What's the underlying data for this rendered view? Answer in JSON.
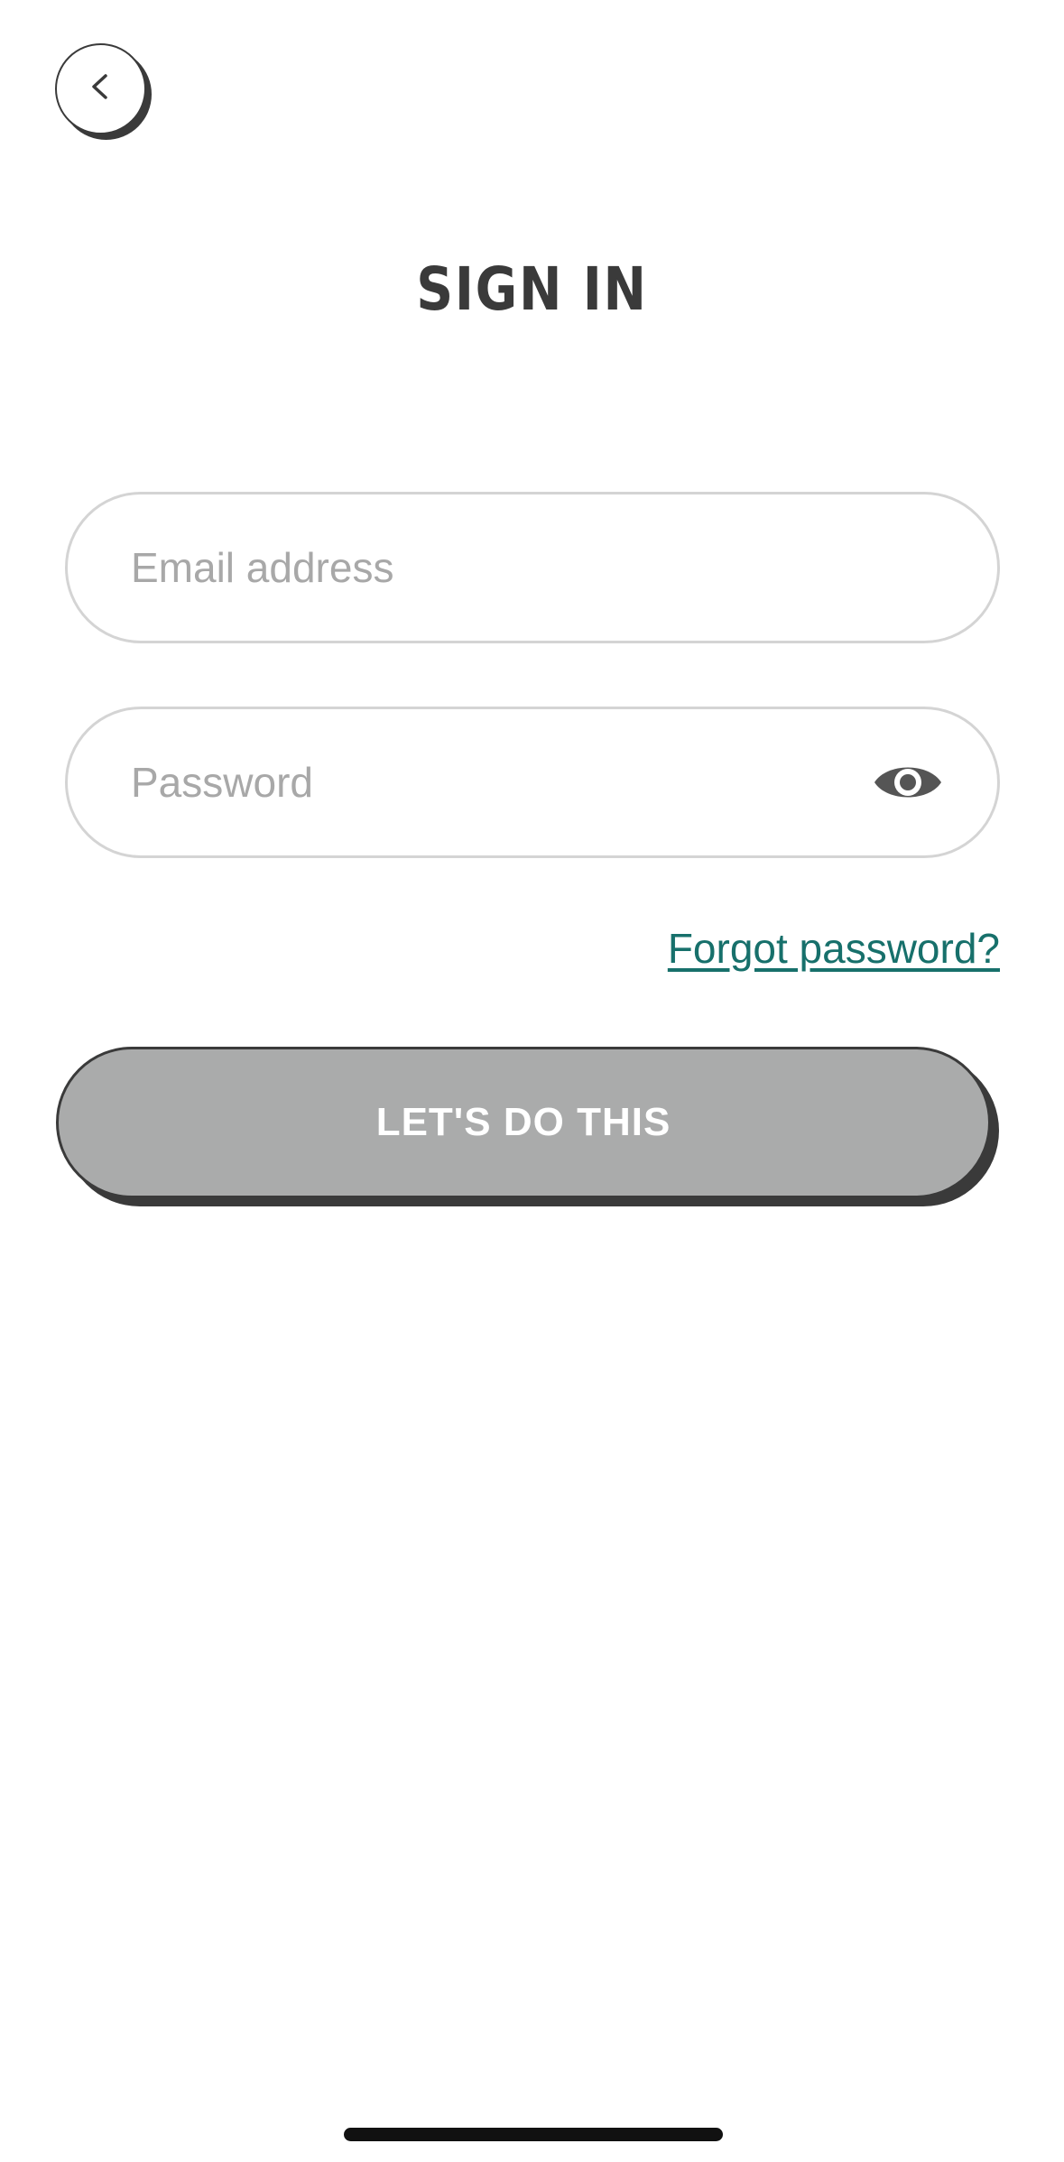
{
  "header": {
    "back_icon": "chevron-left-icon",
    "title": "SIGN IN"
  },
  "form": {
    "email": {
      "value": "",
      "placeholder": "Email address"
    },
    "password": {
      "value": "",
      "placeholder": "Password",
      "toggle_icon": "eye-icon"
    },
    "forgot_password_label": "Forgot password?",
    "submit_label": "LET'S DO THIS"
  },
  "colors": {
    "text_dark": "#3a3a3a",
    "link": "#17706b",
    "button_disabled": "#aaabab",
    "field_border": "#d4d4d4",
    "placeholder": "#a8a8a8"
  }
}
